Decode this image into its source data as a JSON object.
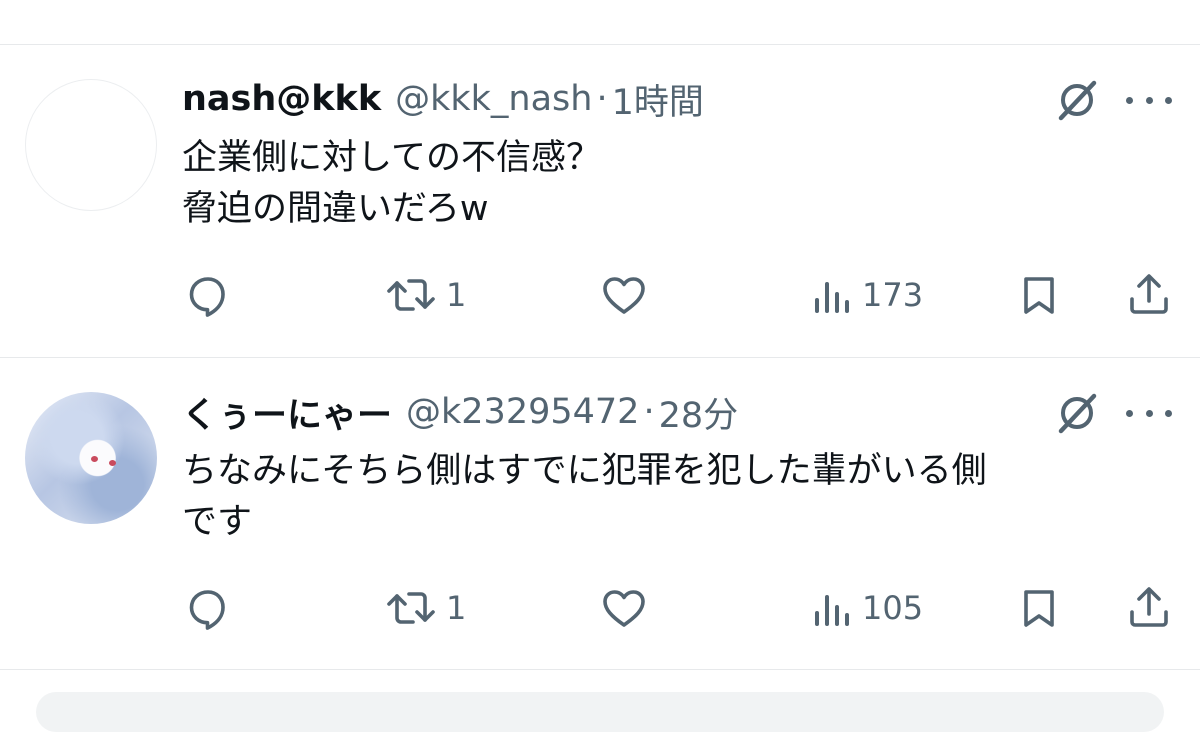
{
  "tweets": [
    {
      "display_name": "nash@kkk",
      "handle": "@kkk_nash",
      "separator": "·",
      "time": "1時間",
      "text_lines": [
        "企業側に対しての不信感？",
        "脅迫の間違いだろw"
      ],
      "retweets": "1",
      "views": "173",
      "avatar": "blank"
    },
    {
      "display_name": "くぅーにゃー",
      "handle": "@k23295472",
      "separator": "·",
      "time": "28分",
      "text_lines": [
        "ちなみにそちら側はすでに犯罪を犯した輩がいる側",
        "です"
      ],
      "retweets": "1",
      "views": "105",
      "avatar": "anime-character"
    }
  ],
  "icons": {
    "reply": "reply-icon",
    "retweet": "retweet-icon",
    "like": "heart-icon",
    "views": "views-icon",
    "bookmark": "bookmark-icon",
    "share": "share-icon",
    "grok": "grok-icon",
    "more": "more-icon"
  },
  "colors": {
    "text": "#0f1419",
    "secondary": "#536471",
    "divider": "#e7e9eb"
  }
}
